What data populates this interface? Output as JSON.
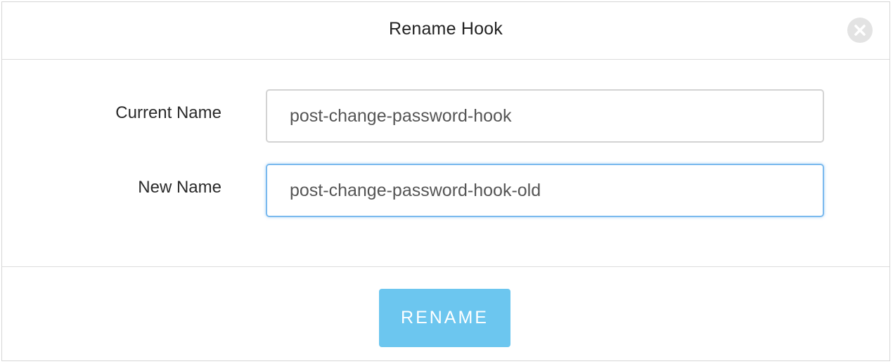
{
  "dialog": {
    "title": "Rename Hook",
    "close_icon": "close-icon"
  },
  "form": {
    "current_name_label": "Current Name",
    "current_name_value": "post-change-password-hook",
    "new_name_label": "New Name",
    "new_name_value": "post-change-password-hook-old"
  },
  "footer": {
    "rename_label": "RENAME"
  },
  "colors": {
    "button_bg": "#6cc6ef",
    "focus_border": "#7ab9ee"
  }
}
